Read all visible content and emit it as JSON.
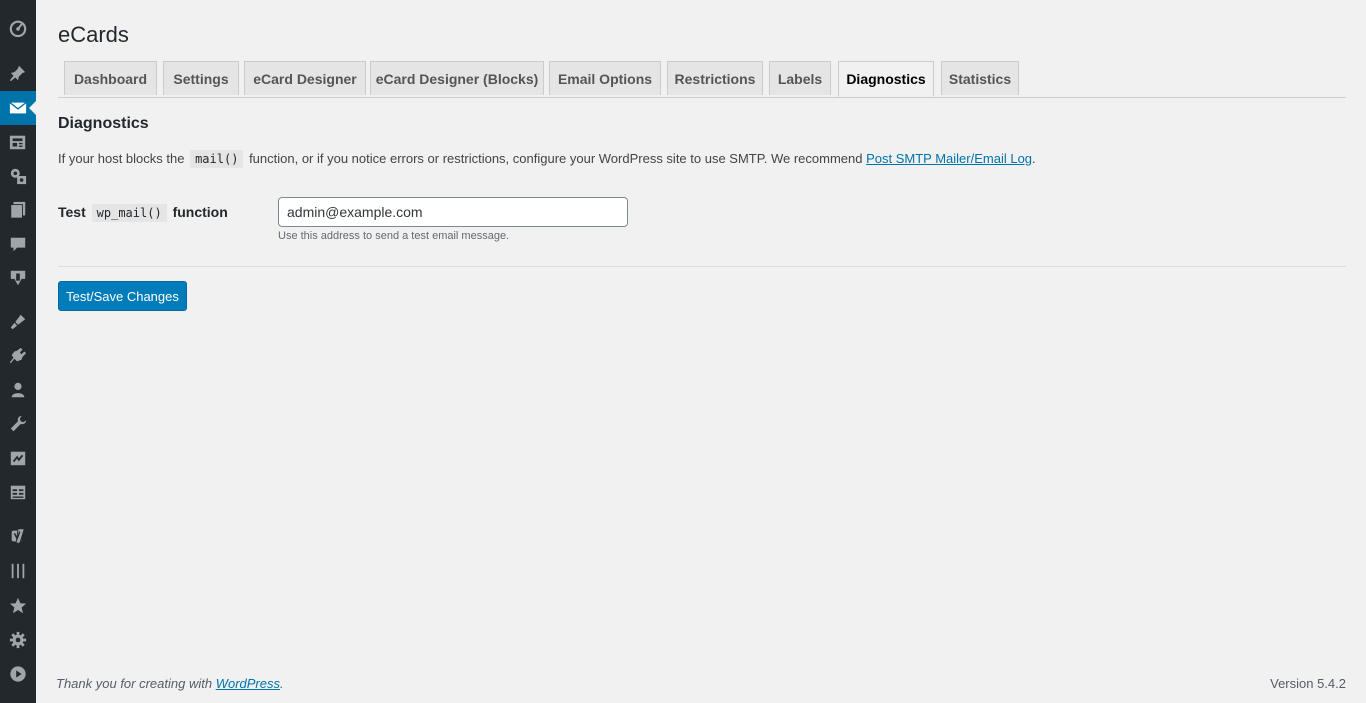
{
  "sidebar": {
    "icons": [
      "dashboard-icon",
      "pin-icon",
      "envelope-icon",
      "media-icon",
      "tools-icon",
      "pages-icon",
      "comments-icon",
      "download-icon",
      "appearance-icon",
      "plugins-icon",
      "users-icon",
      "wrench-icon",
      "import-icon",
      "table-icon",
      "yoast-icon",
      "columns-icon",
      "star-icon",
      "gear-icon",
      "play-icon"
    ],
    "active_icon": "envelope-icon",
    "background": "#23282d",
    "accent": "#0073aa"
  },
  "page": {
    "title": "eCards"
  },
  "tabs": [
    {
      "label": "Dashboard"
    },
    {
      "label": "Settings"
    },
    {
      "label": "eCard Designer"
    },
    {
      "label": "eCard Designer (Blocks)"
    },
    {
      "label": "Email Options"
    },
    {
      "label": "Restrictions"
    },
    {
      "label": "Labels"
    },
    {
      "label": "Diagnostics",
      "active": true
    },
    {
      "label": "Statistics"
    }
  ],
  "section": {
    "title": "Diagnostics",
    "intro_before": "If your host blocks the",
    "intro_code": "mail()",
    "intro_after": "function, or if you notice errors or restrictions, configure your WordPress site to use SMTP. We recommend",
    "intro_link": "Post SMTP Mailer/Email Log",
    "intro_end": "."
  },
  "test_field": {
    "label_before": "Test",
    "label_code": "wp_mail()",
    "label_after": "function",
    "value": "admin@example.com",
    "description": "Use this address to send a test email message."
  },
  "submit": {
    "label": "Test/Save Changes"
  },
  "footer": {
    "thanks": "Thank you for creating with",
    "link": "WordPress",
    "period": ".",
    "version": "Version 5.4.2"
  }
}
